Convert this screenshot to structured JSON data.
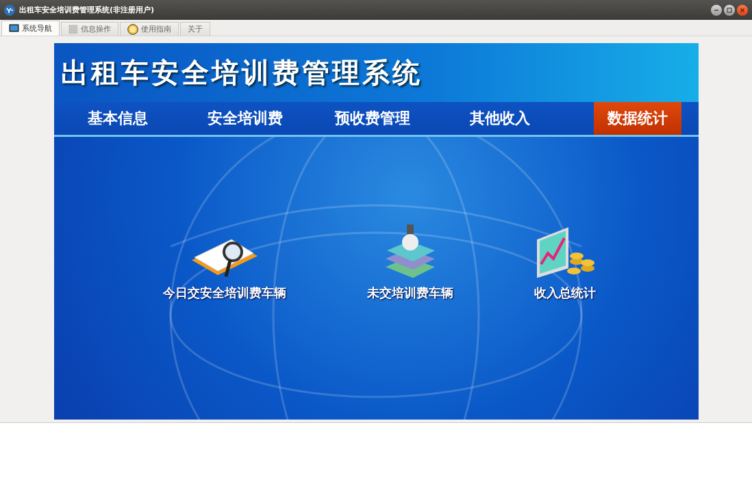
{
  "window": {
    "title": "出租车安全培训费管理系统(非注册用户)"
  },
  "tabs": [
    {
      "label": "系统导航",
      "selected": true,
      "kind": "monitor"
    },
    {
      "label": "信息操作",
      "selected": false,
      "kind": "grid"
    },
    {
      "label": "使用指南",
      "selected": false,
      "kind": "help"
    },
    {
      "label": "关于",
      "selected": false,
      "kind": "plain"
    }
  ],
  "banner": {
    "title": "出租车安全培训费管理系统"
  },
  "nav": [
    {
      "label": "基本信息",
      "selected": false
    },
    {
      "label": "安全培训费",
      "selected": false
    },
    {
      "label": "预收费管理",
      "selected": false
    },
    {
      "label": "其他收入",
      "selected": false
    },
    {
      "label": "数据统计",
      "selected": true
    }
  ],
  "shortcuts": [
    {
      "label": "今日交安全培训费车辆",
      "kind": "search"
    },
    {
      "label": "未交培训费车辆",
      "kind": "books"
    },
    {
      "label": "收入总统计",
      "kind": "chart"
    }
  ]
}
